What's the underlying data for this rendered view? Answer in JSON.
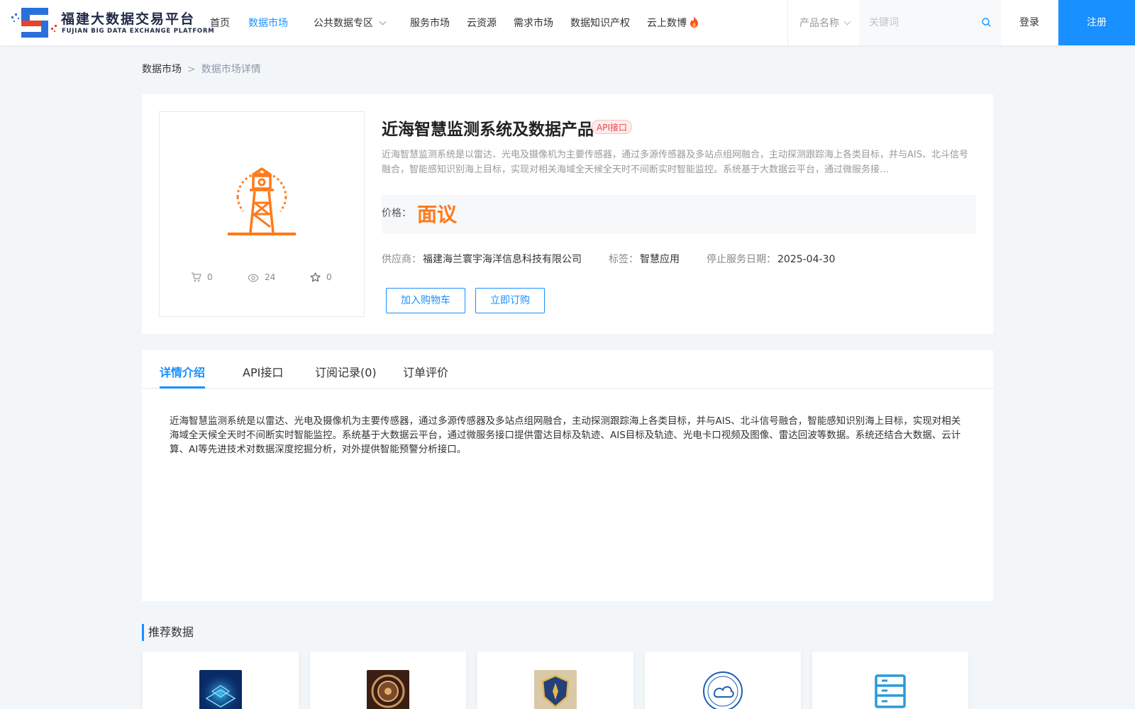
{
  "header": {
    "logo_cn": "福建大数据交易平台",
    "logo_en": "FUJIAN BIG DATA EXCHANGE  PLATFORM",
    "nav": [
      {
        "label": "首页",
        "active": false
      },
      {
        "label": "数据市场",
        "active": true
      },
      {
        "label": "公共数据专区",
        "active": false,
        "dropdown": true
      },
      {
        "label": "服务市场",
        "active": false
      },
      {
        "label": "云资源",
        "active": false
      },
      {
        "label": "需求市场",
        "active": false
      },
      {
        "label": "数据知识产权",
        "active": false
      },
      {
        "label": "云上数博",
        "active": false,
        "icon": "fire-icon"
      }
    ],
    "search": {
      "select_value": "产品名称",
      "placeholder": "关键词",
      "value": ""
    },
    "login_label": "登录",
    "register_label": "注册"
  },
  "breadcrumb": {
    "home": "数据市场",
    "separator": ">",
    "current": "数据市场详情"
  },
  "product": {
    "title": "近海智慧监测系统及数据产品",
    "badge": "API接口",
    "description": "近海智慧监测系统是以雷达、光电及摄像机为主要传感器，通过多源传感器及多站点组网融合，主动探测跟踪海上各类目标，并与AIS、北斗信号融合，智能感知识别海上目标，实现对相关海域全天候全天时不间断实时智能监控。系统基于大数据云平台，通过微服务接…",
    "price_label": "价格：",
    "price_value": "面议",
    "supplier_label": "供应商：",
    "supplier_value": "福建海兰寰宇海洋信息科技有限公司",
    "tag_label": "标签：",
    "tag_value": "智慧应用",
    "stop_date_label": "停止服务日期：",
    "stop_date_value": "2025-04-30",
    "add_cart_label": "加入购物车",
    "subscribe_label": "立即订购",
    "stats": {
      "cart": "0",
      "views": "24",
      "favorites": "0"
    },
    "image_icon": "lighthouse-icon",
    "accent_color": "#ff7a1a"
  },
  "tabs": [
    {
      "label": "详情介绍",
      "active": true
    },
    {
      "label": "API接口",
      "active": false
    },
    {
      "label": "订阅记录(0)",
      "active": false
    },
    {
      "label": "订单评价",
      "active": false
    }
  ],
  "detail_text": "近海智慧监测系统是以雷达、光电及摄像机为主要传感器，通过多源传感器及多站点组网融合，主动探测跟踪海上各类目标，并与AIS、北斗信号融合，智能感知识别海上目标，实现对相关海域全天候全天时不间断实时智能监控。系统基于大数据云平台，通过微服务接口提供雷达目标及轨迹、AIS目标及轨迹、光电卡口视频及图像、雷达回波等数据。系统还结合大数据、云计算、AI等先进技术对数据深度挖掘分析，对外提供智能预警分析接口。",
  "recommend": {
    "title": "推荐数据",
    "items": [
      {
        "thumb": "blue-tech-thumbnail"
      },
      {
        "thumb": "bronze-emblem-thumbnail"
      },
      {
        "thumb": "shield-emblem-thumbnail"
      },
      {
        "thumb": "weather-logo-thumbnail"
      },
      {
        "thumb": "server-icon-thumbnail"
      }
    ]
  },
  "colors": {
    "primary": "#1890ff",
    "price": "#ff7a1a",
    "badge": "#e5484d"
  }
}
